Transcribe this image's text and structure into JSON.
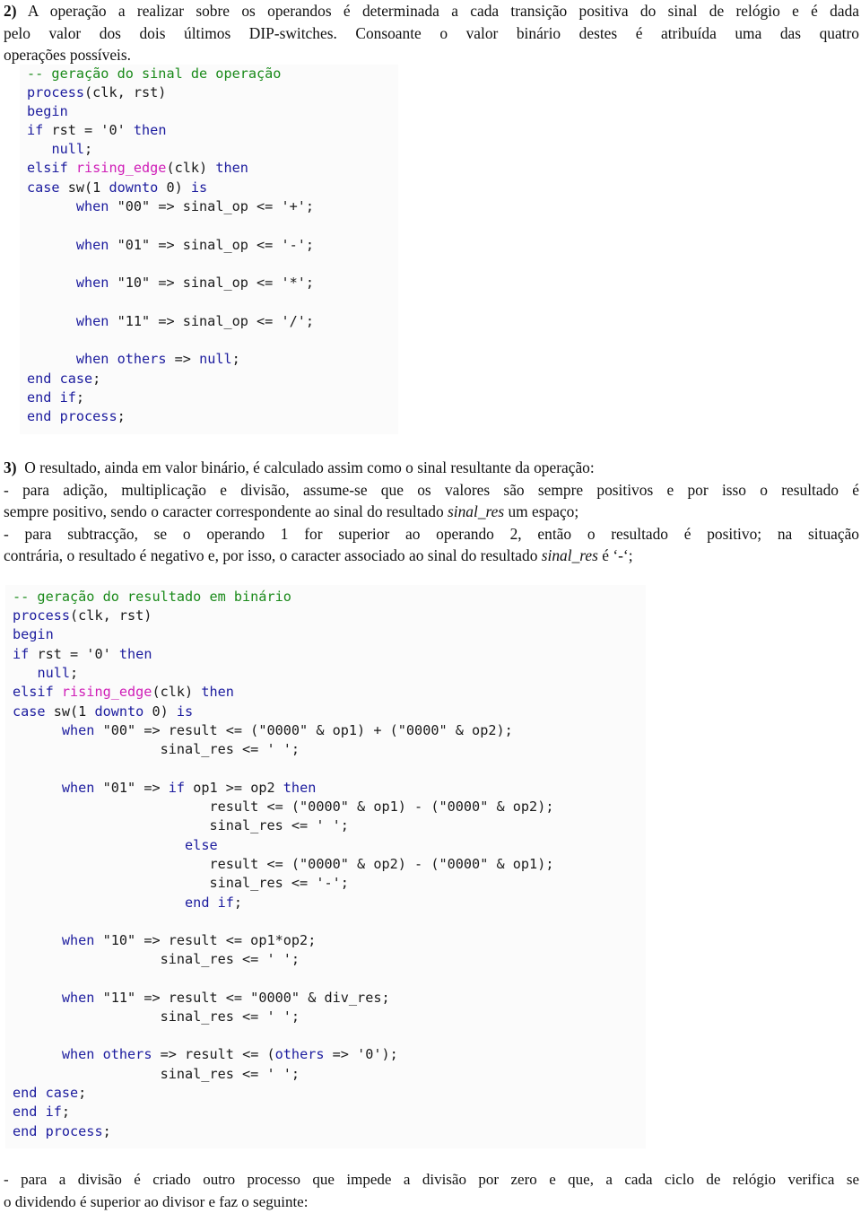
{
  "section2": {
    "number": "2)",
    "lines": [
      "A operação a realizar sobre os operandos é determinada a cada transição positiva do sinal de relógio e é dada",
      "pelo valor dos dois últimos DIP-switches. Consoante o valor binário destes é atribuída uma das quatro",
      "operações possíveis."
    ]
  },
  "code1": {
    "lines": [
      {
        "indent": 0,
        "parts": [
          {
            "t": "-- geração do sinal de operação",
            "c": "cm"
          }
        ]
      },
      {
        "indent": 0,
        "parts": [
          {
            "t": "process",
            "c": "kw"
          },
          {
            "t": "(clk, rst)",
            "c": ""
          }
        ]
      },
      {
        "indent": 0,
        "parts": [
          {
            "t": "begin",
            "c": "kw"
          }
        ]
      },
      {
        "indent": 0,
        "parts": [
          {
            "t": "if",
            "c": "kw"
          },
          {
            "t": " rst = '0' ",
            "c": ""
          },
          {
            "t": "then",
            "c": "kw"
          }
        ]
      },
      {
        "indent": 3,
        "parts": [
          {
            "t": "null",
            "c": "kw"
          },
          {
            "t": ";",
            "c": ""
          }
        ]
      },
      {
        "indent": 0,
        "parts": [
          {
            "t": "elsif",
            "c": "kw"
          },
          {
            "t": " ",
            "c": ""
          },
          {
            "t": "rising_edge",
            "c": "fn"
          },
          {
            "t": "(clk) ",
            "c": ""
          },
          {
            "t": "then",
            "c": "kw"
          }
        ]
      },
      {
        "indent": 0,
        "parts": [
          {
            "t": "case",
            "c": "kw"
          },
          {
            "t": " sw(1 ",
            "c": ""
          },
          {
            "t": "downto",
            "c": "kw"
          },
          {
            "t": " 0) ",
            "c": ""
          },
          {
            "t": "is",
            "c": "kw"
          }
        ]
      },
      {
        "indent": 6,
        "parts": [
          {
            "t": "when",
            "c": "kw"
          },
          {
            "t": " \"00\" => sinal_op <= '+';",
            "c": ""
          }
        ]
      },
      {
        "indent": 6,
        "parts": [
          {
            "t": "when",
            "c": "kw"
          },
          {
            "t": " \"01\" => sinal_op <= '-';",
            "c": ""
          }
        ]
      },
      {
        "indent": 6,
        "parts": [
          {
            "t": "when",
            "c": "kw"
          },
          {
            "t": " \"10\" => sinal_op <= '*';",
            "c": ""
          }
        ]
      },
      {
        "indent": 6,
        "parts": [
          {
            "t": "when",
            "c": "kw"
          },
          {
            "t": " \"11\" => sinal_op <= '/';",
            "c": ""
          }
        ]
      },
      {
        "indent": 6,
        "parts": [
          {
            "t": "when",
            "c": "kw"
          },
          {
            "t": " ",
            "c": ""
          },
          {
            "t": "others",
            "c": "kw"
          },
          {
            "t": " => ",
            "c": ""
          },
          {
            "t": "null",
            "c": "kw"
          },
          {
            "t": ";",
            "c": ""
          }
        ]
      },
      {
        "indent": 0,
        "parts": [
          {
            "t": "end",
            "c": "kw"
          },
          {
            "t": " ",
            "c": ""
          },
          {
            "t": "case",
            "c": "kw"
          },
          {
            "t": ";",
            "c": ""
          }
        ]
      },
      {
        "indent": 0,
        "parts": [
          {
            "t": "end",
            "c": "kw"
          },
          {
            "t": " ",
            "c": ""
          },
          {
            "t": "if",
            "c": "kw"
          },
          {
            "t": ";",
            "c": ""
          }
        ]
      },
      {
        "indent": 0,
        "parts": [
          {
            "t": "end",
            "c": "kw"
          },
          {
            "t": " ",
            "c": ""
          },
          {
            "t": "process",
            "c": "kw"
          },
          {
            "t": ";",
            "c": ""
          }
        ]
      }
    ]
  },
  "section3": {
    "number": "3)",
    "intro": "O resultado, ainda em valor binário, é calculado assim como o sinal resultante da operação:",
    "bullet1_line1": "- para adição, multiplicação e divisão, assume-se que os valores são sempre positivos e por isso o resultado é",
    "bullet1_line2_pre": "sempre positivo, sendo o caracter correspondente ao sinal do resultado ",
    "bullet1_line2_var": "sinal_res",
    "bullet1_line2_post": " um espaço;",
    "bullet2_line1": "- para subtracção, se o operando 1 for superior ao operando 2, então o resultado é positivo; na situação",
    "bullet2_line2_pre": "contrária, o resultado é negativo e, por isso, o caracter associado ao sinal do resultado ",
    "bullet2_line2_var": "sinal_res",
    "bullet2_line2_post": " é ‘-‘;"
  },
  "code2": {
    "lines": [
      {
        "indent": 0,
        "parts": [
          {
            "t": "-- geração do resultado em binário",
            "c": "cm"
          }
        ]
      },
      {
        "indent": 0,
        "parts": [
          {
            "t": "process",
            "c": "kw"
          },
          {
            "t": "(clk, rst)",
            "c": ""
          }
        ]
      },
      {
        "indent": 0,
        "parts": [
          {
            "t": "begin",
            "c": "kw"
          }
        ]
      },
      {
        "indent": 0,
        "parts": [
          {
            "t": "if",
            "c": "kw"
          },
          {
            "t": " rst = '0' ",
            "c": ""
          },
          {
            "t": "then",
            "c": "kw"
          }
        ]
      },
      {
        "indent": 3,
        "parts": [
          {
            "t": "null",
            "c": "kw"
          },
          {
            "t": ";",
            "c": ""
          }
        ]
      },
      {
        "indent": 0,
        "parts": [
          {
            "t": "elsif",
            "c": "kw"
          },
          {
            "t": " ",
            "c": ""
          },
          {
            "t": "rising_edge",
            "c": "fn"
          },
          {
            "t": "(clk) ",
            "c": ""
          },
          {
            "t": "then",
            "c": "kw"
          }
        ]
      },
      {
        "indent": 0,
        "parts": [
          {
            "t": "case",
            "c": "kw"
          },
          {
            "t": " sw(1 ",
            "c": ""
          },
          {
            "t": "downto",
            "c": "kw"
          },
          {
            "t": " 0) ",
            "c": ""
          },
          {
            "t": "is",
            "c": "kw"
          }
        ]
      },
      {
        "indent": 6,
        "parts": [
          {
            "t": "when",
            "c": "kw"
          },
          {
            "t": " \"00\" => result <= (\"0000\" & op1) + (\"0000\" & op2);",
            "c": ""
          }
        ]
      },
      {
        "indent": 18,
        "parts": [
          {
            "t": "sinal_res <= ' ';",
            "c": ""
          }
        ]
      },
      {
        "indent": 6,
        "parts": [
          {
            "t": "when",
            "c": "kw"
          },
          {
            "t": " \"01\" => ",
            "c": ""
          },
          {
            "t": "if",
            "c": "kw"
          },
          {
            "t": " op1 >= op2 ",
            "c": ""
          },
          {
            "t": "then",
            "c": "kw"
          }
        ]
      },
      {
        "indent": 24,
        "parts": [
          {
            "t": "result <= (\"0000\" & op1) - (\"0000\" & op2);",
            "c": ""
          }
        ]
      },
      {
        "indent": 24,
        "parts": [
          {
            "t": "sinal_res <= ' ';",
            "c": ""
          }
        ]
      },
      {
        "indent": 21,
        "parts": [
          {
            "t": "else",
            "c": "kw"
          }
        ]
      },
      {
        "indent": 24,
        "parts": [
          {
            "t": "result <= (\"0000\" & op2) - (\"0000\" & op1);",
            "c": ""
          }
        ]
      },
      {
        "indent": 24,
        "parts": [
          {
            "t": "sinal_res <= '-';",
            "c": ""
          }
        ]
      },
      {
        "indent": 21,
        "parts": [
          {
            "t": "end",
            "c": "kw"
          },
          {
            "t": " ",
            "c": ""
          },
          {
            "t": "if",
            "c": "kw"
          },
          {
            "t": ";",
            "c": ""
          }
        ]
      },
      {
        "indent": 6,
        "parts": [
          {
            "t": "when",
            "c": "kw"
          },
          {
            "t": " \"10\" => result <= op1*op2;",
            "c": ""
          }
        ]
      },
      {
        "indent": 18,
        "parts": [
          {
            "t": "sinal_res <= ' ';",
            "c": ""
          }
        ]
      },
      {
        "indent": 6,
        "parts": [
          {
            "t": "when",
            "c": "kw"
          },
          {
            "t": " \"11\" => result <= \"0000\" & div_res;",
            "c": ""
          }
        ]
      },
      {
        "indent": 18,
        "parts": [
          {
            "t": "sinal_res <= ' ';",
            "c": ""
          }
        ]
      },
      {
        "indent": 6,
        "parts": [
          {
            "t": "when",
            "c": "kw"
          },
          {
            "t": " ",
            "c": ""
          },
          {
            "t": "others",
            "c": "kw"
          },
          {
            "t": " => result <= (",
            "c": ""
          },
          {
            "t": "others",
            "c": "kw"
          },
          {
            "t": " => '0');",
            "c": ""
          }
        ]
      },
      {
        "indent": 18,
        "parts": [
          {
            "t": "sinal_res <= ' ';",
            "c": ""
          }
        ]
      },
      {
        "indent": 0,
        "parts": [
          {
            "t": "end",
            "c": "kw"
          },
          {
            "t": " ",
            "c": ""
          },
          {
            "t": "case",
            "c": "kw"
          },
          {
            "t": ";",
            "c": ""
          }
        ]
      },
      {
        "indent": 0,
        "parts": [
          {
            "t": "end",
            "c": "kw"
          },
          {
            "t": " ",
            "c": ""
          },
          {
            "t": "if",
            "c": "kw"
          },
          {
            "t": ";",
            "c": ""
          }
        ]
      },
      {
        "indent": 0,
        "parts": [
          {
            "t": "end",
            "c": "kw"
          },
          {
            "t": " ",
            "c": ""
          },
          {
            "t": "process",
            "c": "kw"
          },
          {
            "t": ";",
            "c": ""
          }
        ]
      }
    ]
  },
  "closing": {
    "line1": "- para a divisão é criado outro processo que impede a divisão por zero e que, a cada ciclo de relógio verifica se",
    "line2": "o dividendo é superior ao divisor e faz o seguinte:"
  }
}
